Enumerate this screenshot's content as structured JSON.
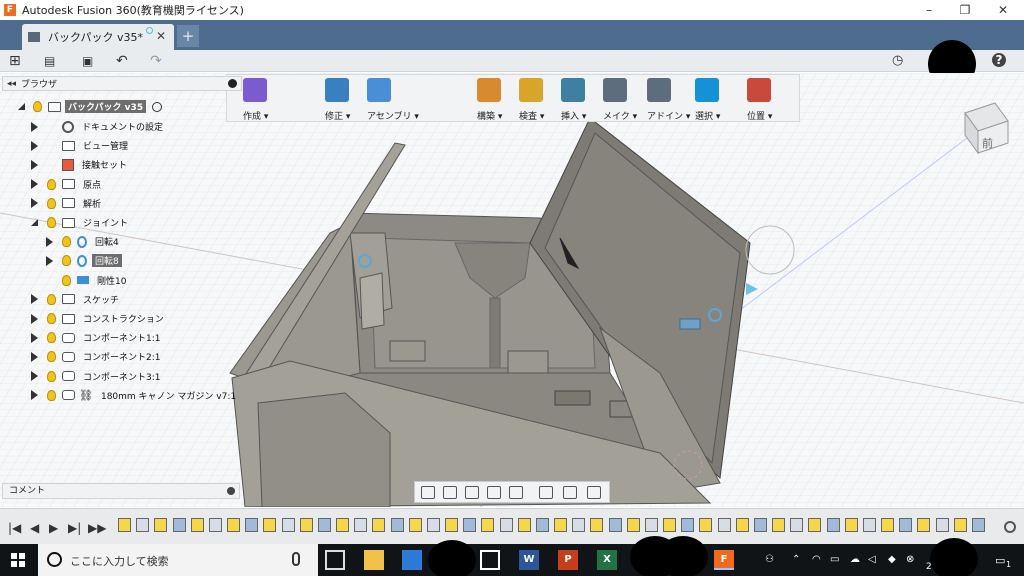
{
  "window": {
    "title": "Autodesk Fusion 360(教育機関ライセンス)",
    "minimize": "–",
    "restore": "❐",
    "close": "✕"
  },
  "tab": {
    "label": "バックパック v35*",
    "close": "✕",
    "new": "+"
  },
  "quickbar": {
    "grid": "⊞",
    "file": "▤",
    "save": "▣",
    "undo": "↶",
    "redo": "↷",
    "history": "◷",
    "help": "?"
  },
  "ribbon": {
    "groups": [
      {
        "label": "作成 ▾",
        "color": "#7c5bd1"
      },
      {
        "label": "修正 ▾",
        "color": "#3a7fc1"
      },
      {
        "label": "アセンブリ ▾",
        "color": "#4a8ed6"
      },
      {
        "label": "構築 ▾",
        "color": "#d88a2e"
      },
      {
        "label": "検査 ▾",
        "color": "#d6a52a"
      },
      {
        "label": "挿入 ▾",
        "color": "#3f7fa3"
      },
      {
        "label": "メイク ▾",
        "color": "#5d6d7d"
      },
      {
        "label": "アドイン ▾",
        "color": "#5d6d7d"
      },
      {
        "label": "選択 ▾",
        "color": "#1591d6"
      },
      {
        "label": "位置 ▾",
        "color": "#c94a3a"
      }
    ]
  },
  "browser": {
    "collapse": "◂◂",
    "title": "ブラウザ",
    "root": "バックパック v35",
    "items": [
      {
        "label": "ドキュメントの設定",
        "indent": 1,
        "type": "gear",
        "bulb": false
      },
      {
        "label": "ビュー管理",
        "indent": 1,
        "type": "folder",
        "bulb": false
      },
      {
        "label": "接触セット",
        "indent": 1,
        "type": "contact",
        "bulb": false
      },
      {
        "label": "原点",
        "indent": 1,
        "type": "folder",
        "bulb": true
      },
      {
        "label": "解析",
        "indent": 1,
        "type": "folder",
        "bulb": true
      },
      {
        "label": "ジョイント",
        "indent": 1,
        "type": "folder",
        "bulb": true,
        "open": true
      },
      {
        "label": "回転4",
        "indent": 2,
        "type": "joint",
        "bulb": true
      },
      {
        "label": "回転8",
        "indent": 2,
        "type": "joint",
        "bulb": true,
        "selected": true
      },
      {
        "label": "剛性10",
        "indent": 2,
        "type": "rigid",
        "bulb": true,
        "noarrow": true
      },
      {
        "label": "スケッチ",
        "indent": 1,
        "type": "folder",
        "bulb": true
      },
      {
        "label": "コンストラクション",
        "indent": 1,
        "type": "folder",
        "bulb": true
      },
      {
        "label": "コンポーネント1:1",
        "indent": 1,
        "type": "comp",
        "bulb": true
      },
      {
        "label": "コンポーネント2:1",
        "indent": 1,
        "type": "comp",
        "bulb": true
      },
      {
        "label": "コンポーネント3:1",
        "indent": 1,
        "type": "comp",
        "bulb": true
      },
      {
        "label": "180mm キャノン マガジン v7:1",
        "indent": 1,
        "type": "link",
        "bulb": true
      }
    ]
  },
  "comment": {
    "label": "コメント"
  },
  "viewcube": {
    "label": "前"
  },
  "timeline": {
    "controls": [
      "|◀",
      "◀",
      "▶",
      "▶|",
      "▶▶"
    ],
    "feature_count": 48
  },
  "taskbar": {
    "search_placeholder": "ここに入力して検索",
    "time_partial": "2",
    "notif": "1"
  }
}
